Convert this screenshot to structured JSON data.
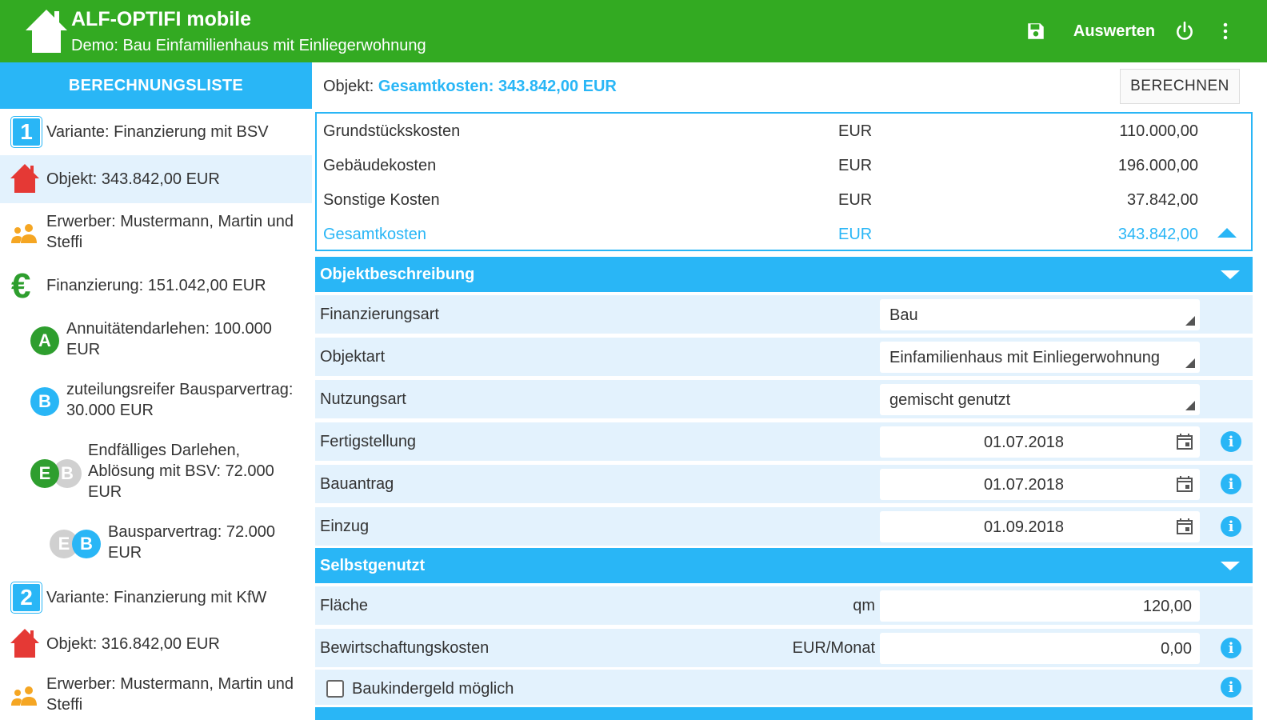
{
  "app": {
    "title": "ALF-OPTIFI mobile",
    "subtitle": "Demo: Bau Einfamilienhaus mit Einliegerwohnung",
    "actions": {
      "save_icon": "save-icon",
      "auswerten_label": "Auswerten",
      "power_icon": "power-icon",
      "more_icon": "more-vert-icon"
    }
  },
  "colors": {
    "appbar": "#33aa22",
    "accent": "#29b6f6",
    "row_bg": "#e3f2fd",
    "euro_green": "#2e9e2e",
    "house_red": "#e53935",
    "people_orange": "#f5a623"
  },
  "sidebar": {
    "header": "BERECHNUNGSLISTE",
    "items": [
      {
        "icon": "number-badge-icon",
        "badge": "1",
        "label": "Variante: Finanzierung mit BSV"
      },
      {
        "icon": "house-icon",
        "label": "Objekt: 343.842,00 EUR",
        "selected": true
      },
      {
        "icon": "people-icon",
        "label": "Erwerber: Mustermann, Martin und Steffi"
      },
      {
        "icon": "euro-icon",
        "glyph": "€",
        "label": "Finanzierung: 151.042,00 EUR"
      },
      {
        "icon": "circle-a-icon",
        "badge": "A",
        "label": "Annuitätendarlehen: 100.000 EUR"
      },
      {
        "icon": "circle-b-icon",
        "badge": "B",
        "label": "zuteilungsreifer Bausparvertrag: 30.000 EUR"
      },
      {
        "icon": "circle-e-b-icon",
        "badge": "E",
        "badge2": "B",
        "label": "Endfälliges Darlehen, Ablösung mit BSV: 72.000 EUR"
      },
      {
        "icon": "circle-e-b-icon",
        "badge": "E",
        "badge2": "B",
        "label": "Bausparvertrag: 72.000 EUR"
      },
      {
        "icon": "number-badge-icon",
        "badge": "2",
        "label": "Variante: Finanzierung mit KfW"
      },
      {
        "icon": "house-icon",
        "label": "Objekt: 316.842,00 EUR"
      },
      {
        "icon": "people-icon",
        "label": "Erwerber: Mustermann, Martin und Steffi"
      }
    ]
  },
  "main": {
    "header_prefix": "Objekt:",
    "header_value": "Gesamtkosten: 343.842,00 EUR",
    "calc_button": "BERECHNEN",
    "costs": [
      {
        "name": "Grundstückskosten",
        "unit": "EUR",
        "value": "110.000,00"
      },
      {
        "name": "Gebäudekosten",
        "unit": "EUR",
        "value": "196.000,00"
      },
      {
        "name": "Sonstige Kosten",
        "unit": "EUR",
        "value": "37.842,00"
      },
      {
        "name": "Gesamtkosten",
        "unit": "EUR",
        "value": "343.842,00"
      }
    ],
    "section1": "Objektbeschreibung",
    "fields1": [
      {
        "label": "Finanzierungsart",
        "value": "Bau"
      },
      {
        "label": "Objektart",
        "value": "Einfamilienhaus mit Einliegerwohnung"
      },
      {
        "label": "Nutzungsart",
        "value": "gemischt genutzt"
      },
      {
        "label": "Fertigstellung",
        "value": "01.07.2018"
      },
      {
        "label": "Bauantrag",
        "value": "01.07.2018"
      },
      {
        "label": "Einzug",
        "value": "01.09.2018"
      }
    ],
    "section2": "Selbstgenutzt",
    "fields2": [
      {
        "label": "Fläche",
        "unit": "qm",
        "value": "120,00"
      },
      {
        "label": "Bewirtschaftungskosten",
        "unit": "EUR/Monat",
        "value": "0,00"
      }
    ],
    "checkbox": {
      "label": "Baukindergeld möglich",
      "checked": false
    }
  }
}
